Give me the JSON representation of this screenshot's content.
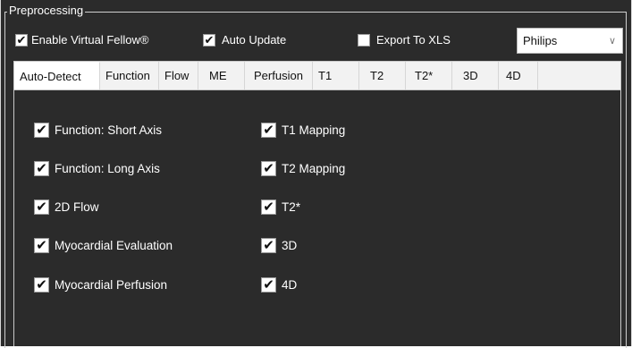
{
  "group_title": "Preprocessing",
  "top": {
    "enable_virtual_fellow": {
      "label": "Enable Virtual Fellow®",
      "checked": true
    },
    "auto_update": {
      "label": "Auto Update",
      "checked": true
    },
    "export_to_xls": {
      "label": "Export To XLS",
      "checked": false
    },
    "vendor_select": {
      "value": "Philips"
    }
  },
  "tabs": [
    {
      "label": "Auto-Detect",
      "active": true
    },
    {
      "label": "Function"
    },
    {
      "label": "Flow"
    },
    {
      "label": "ME"
    },
    {
      "label": "Perfusion"
    },
    {
      "label": "T1"
    },
    {
      "label": "T2"
    },
    {
      "label": "T2*"
    },
    {
      "label": "3D"
    },
    {
      "label": "4D"
    }
  ],
  "auto_detect": {
    "left": [
      {
        "label": "Function: Short Axis",
        "checked": true
      },
      {
        "label": "Function: Long Axis",
        "checked": true
      },
      {
        "label": "2D Flow",
        "checked": true
      },
      {
        "label": "Myocardial Evaluation",
        "checked": true
      },
      {
        "label": "Myocardial Perfusion",
        "checked": true
      }
    ],
    "right": [
      {
        "label": "T1 Mapping",
        "checked": true
      },
      {
        "label": "T2 Mapping",
        "checked": true
      },
      {
        "label": "T2*",
        "checked": true
      },
      {
        "label": "3D",
        "checked": true
      },
      {
        "label": "4D",
        "checked": true
      }
    ]
  },
  "glyphs": {
    "check": "✔",
    "chevron": "∨"
  }
}
